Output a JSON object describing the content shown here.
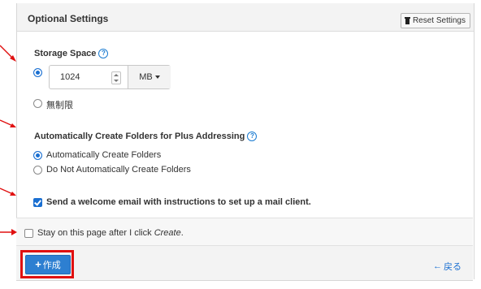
{
  "panel": {
    "title": "Optional Settings",
    "reset_label": "Reset Settings"
  },
  "storage": {
    "label": "Storage Space",
    "help_glyph": "?",
    "value": "1024",
    "unit": "MB",
    "unlimited_label": "無制限"
  },
  "folders": {
    "label": "Automatically Create Folders for Plus Addressing",
    "help_glyph": "?",
    "option_auto": "Automatically Create Folders",
    "option_none": "Do Not Automatically Create Folders"
  },
  "welcome": {
    "label": "Send a welcome email with instructions to set up a mail client."
  },
  "stay": {
    "prefix": "Stay on this page after I click ",
    "emph": "Create",
    "suffix": "."
  },
  "footer": {
    "create_label": "作成",
    "create_icon": "+",
    "back_label": "戻る",
    "back_icon": "←"
  },
  "colors": {
    "accent": "#2d7fd1",
    "annotation": "#e01010"
  }
}
